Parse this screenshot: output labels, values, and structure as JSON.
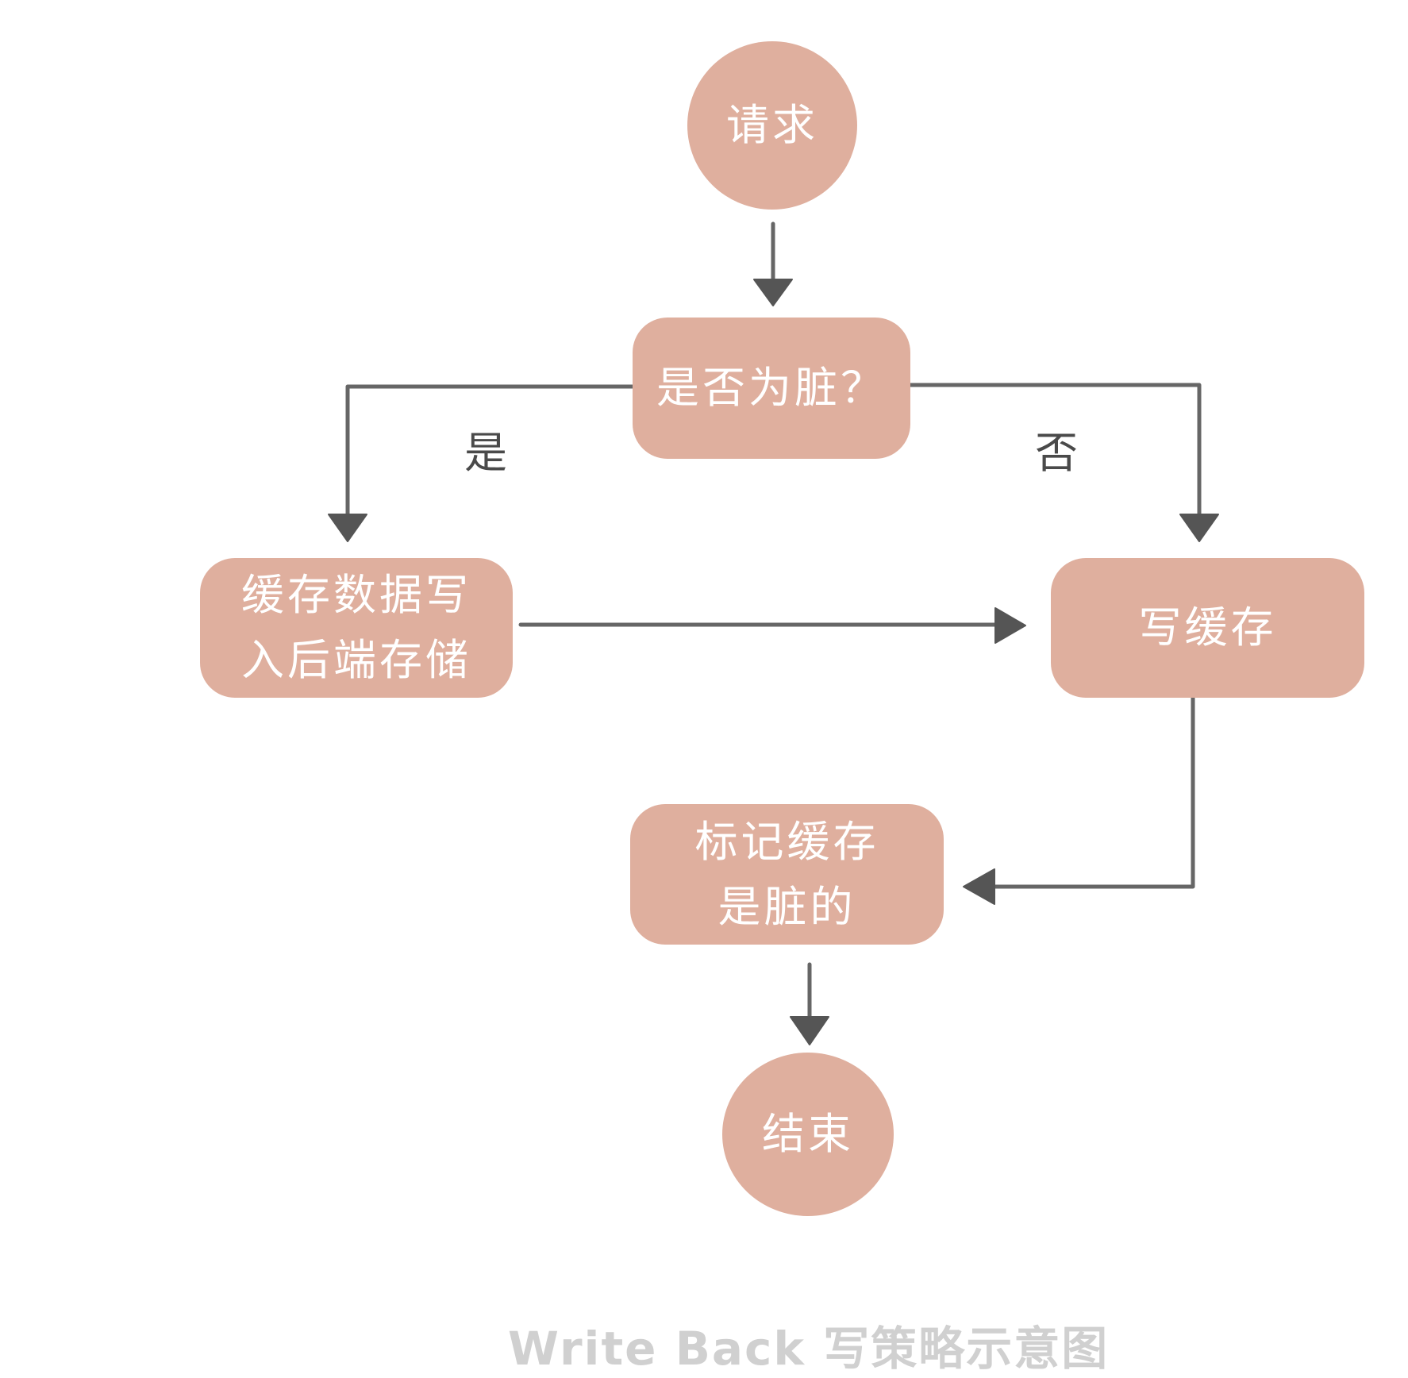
{
  "nodes": {
    "start": "请求",
    "decision": "是否为脏？",
    "write_back_line1": "缓存数据写",
    "write_back_line2": "入后端存储",
    "write_cache": "写缓存",
    "mark_dirty_line1": "标记缓存",
    "mark_dirty_line2": "是脏的",
    "end": "结束"
  },
  "edge_labels": {
    "yes": "是",
    "no": "否"
  },
  "caption": "Write Back 写策略示意图",
  "colors": {
    "node_fill": "#dfaf9e",
    "node_text": "#ffffff",
    "arrow": "#666666",
    "caption": "#d0d0d0"
  }
}
